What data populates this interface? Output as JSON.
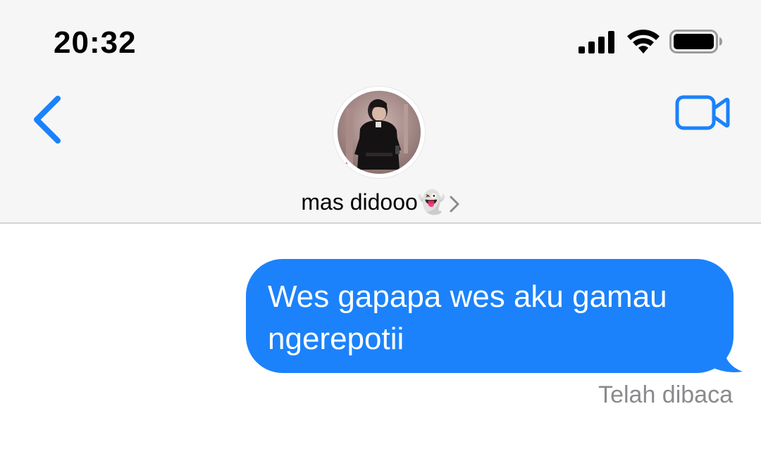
{
  "status_bar": {
    "time": "20:32",
    "signal_icon": "cellular-signal-icon",
    "wifi_icon": "wifi-icon",
    "battery_icon": "battery-icon"
  },
  "nav": {
    "back_icon": "chevron-left-icon",
    "video_icon": "video-camera-icon",
    "accent_color": "#1b82fb"
  },
  "contact": {
    "name": "mas didooo👻",
    "chevron_icon": "chevron-right-icon"
  },
  "conversation": {
    "messages": [
      {
        "direction": "outgoing",
        "text": "Wes gapapa wes aku gamau ngerepotii",
        "bubble_color": "#1b82fb"
      }
    ],
    "read_receipt": "Telah dibaca"
  }
}
